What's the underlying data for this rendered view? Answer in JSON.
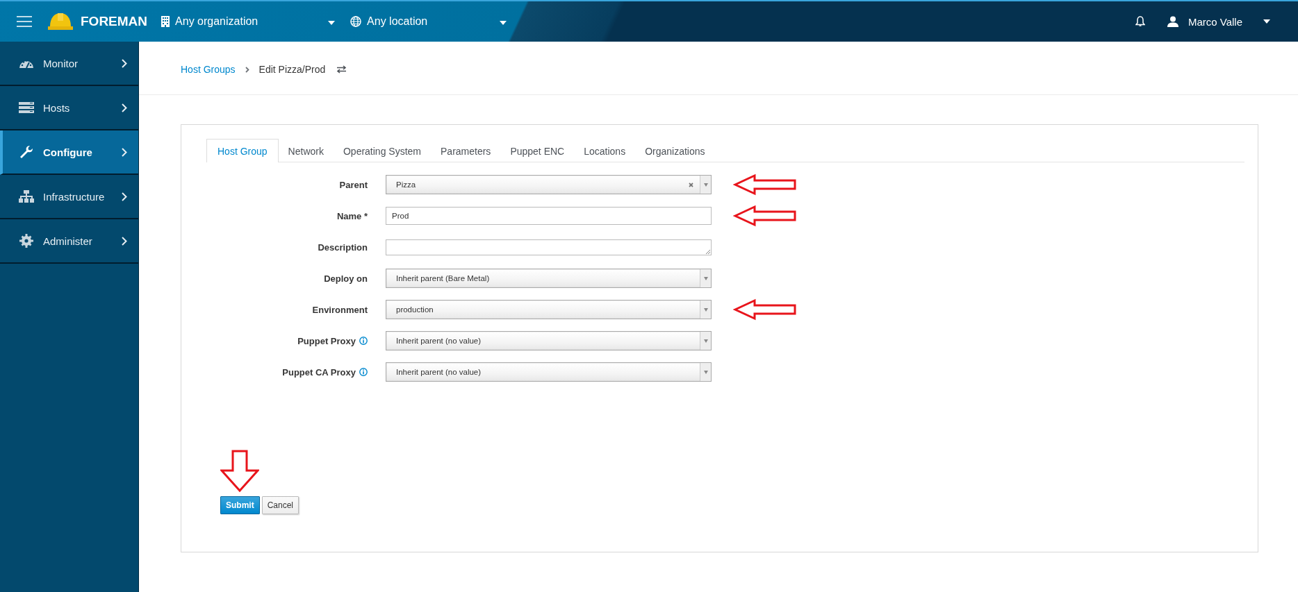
{
  "header": {
    "brand": "FOREMAN",
    "organization": "Any organization",
    "location": "Any location",
    "user": "Marco Valle"
  },
  "sidebar": {
    "items": [
      {
        "label": "Monitor",
        "selected": false
      },
      {
        "label": "Hosts",
        "selected": false
      },
      {
        "label": "Configure",
        "selected": true
      },
      {
        "label": "Infrastructure",
        "selected": false
      },
      {
        "label": "Administer",
        "selected": false
      }
    ]
  },
  "breadcrumb": {
    "parent": "Host Groups",
    "current": "Edit Pizza/Prod"
  },
  "tabs": [
    {
      "label": "Host Group",
      "selected": true
    },
    {
      "label": "Network",
      "selected": false
    },
    {
      "label": "Operating System",
      "selected": false
    },
    {
      "label": "Parameters",
      "selected": false
    },
    {
      "label": "Puppet ENC",
      "selected": false
    },
    {
      "label": "Locations",
      "selected": false
    },
    {
      "label": "Organizations",
      "selected": false
    }
  ],
  "fields": [
    {
      "label": "Parent",
      "kind": "select",
      "value": "Pizza",
      "clearable": true,
      "marked": true
    },
    {
      "label": "Name *",
      "kind": "text",
      "value": "Prod",
      "marked": true
    },
    {
      "label": "Description",
      "kind": "textarea",
      "marked": false
    },
    {
      "label": "Deploy on",
      "kind": "select",
      "value": "Inherit parent (Bare Metal)",
      "marked": false
    },
    {
      "label": "Environment",
      "kind": "select",
      "value": "production",
      "marked": true
    },
    {
      "label": "Puppet Proxy",
      "kind": "select",
      "value": "Inherit parent (no value)",
      "info": true,
      "marked": false
    },
    {
      "label": "Puppet CA Proxy",
      "kind": "select",
      "value": "Inherit parent (no value)",
      "info": true,
      "marked": false
    }
  ],
  "buttons": [
    {
      "label": "Submit",
      "kind": "primary",
      "marked": true
    },
    {
      "label": "Cancel",
      "kind": "default",
      "marked": false
    }
  ]
}
